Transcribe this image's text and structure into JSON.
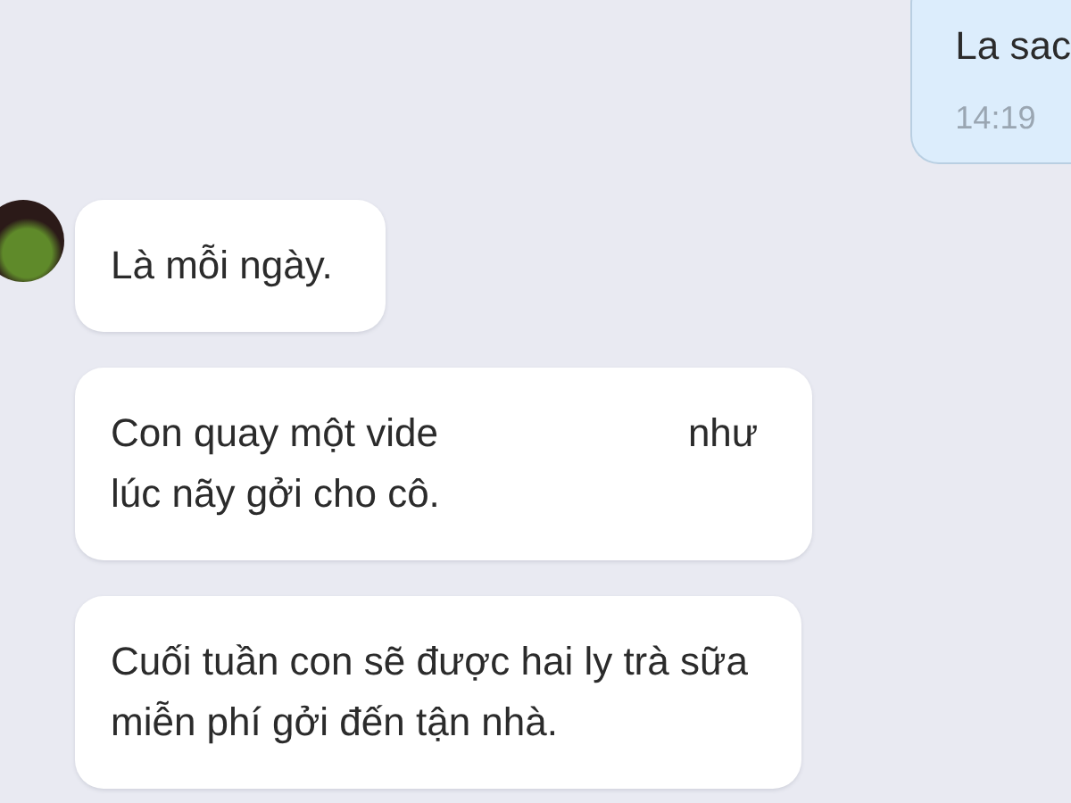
{
  "messages": [
    {
      "kind": "outgoing",
      "lines": [
        [
          "La sac"
        ]
      ],
      "time": "14:19"
    },
    {
      "kind": "incoming",
      "avatar": true,
      "lines": [
        [
          "Là mỗi ngày."
        ]
      ]
    },
    {
      "kind": "incoming",
      "avatar": false,
      "lines": [
        [
          "Con quay một vide",
          "như"
        ],
        [
          "lúc nãy gởi cho cô."
        ]
      ]
    },
    {
      "kind": "incoming",
      "avatar": false,
      "lines": [
        [
          "Cuối tuần con sẽ được hai ly trà sữa"
        ],
        [
          "miễn phí gởi đến tận nhà."
        ]
      ]
    }
  ]
}
